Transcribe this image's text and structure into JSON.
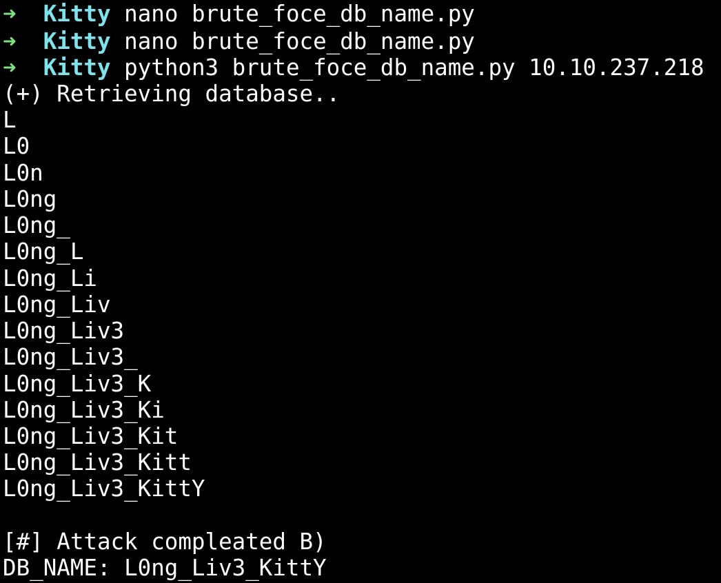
{
  "theme": {
    "background": "#000000",
    "foreground": "#ffffff",
    "prompt_arrow_color": "#7ee07e",
    "prompt_dir_color": "#7fe3ee"
  },
  "prompt": {
    "arrow": "➜",
    "dir": "Kitty"
  },
  "commands": [
    "nano brute_foce_db_name.py",
    "nano brute_foce_db_name.py",
    "python3 brute_foce_db_name.py 10.10.237.218"
  ],
  "output": {
    "retrieving": "(+) Retrieving database..",
    "progress": [
      "L",
      "L0",
      "L0n",
      "L0ng",
      "L0ng_",
      "L0ng_L",
      "L0ng_Li",
      "L0ng_Liv",
      "L0ng_Liv3",
      "L0ng_Liv3_",
      "L0ng_Liv3_K",
      "L0ng_Liv3_Ki",
      "L0ng_Liv3_Kit",
      "L0ng_Liv3_Kitt",
      "L0ng_Liv3_KittY"
    ],
    "completed": "[#] Attack compleated B)",
    "db_name": "DB_NAME: L0ng_Liv3_KittY"
  }
}
